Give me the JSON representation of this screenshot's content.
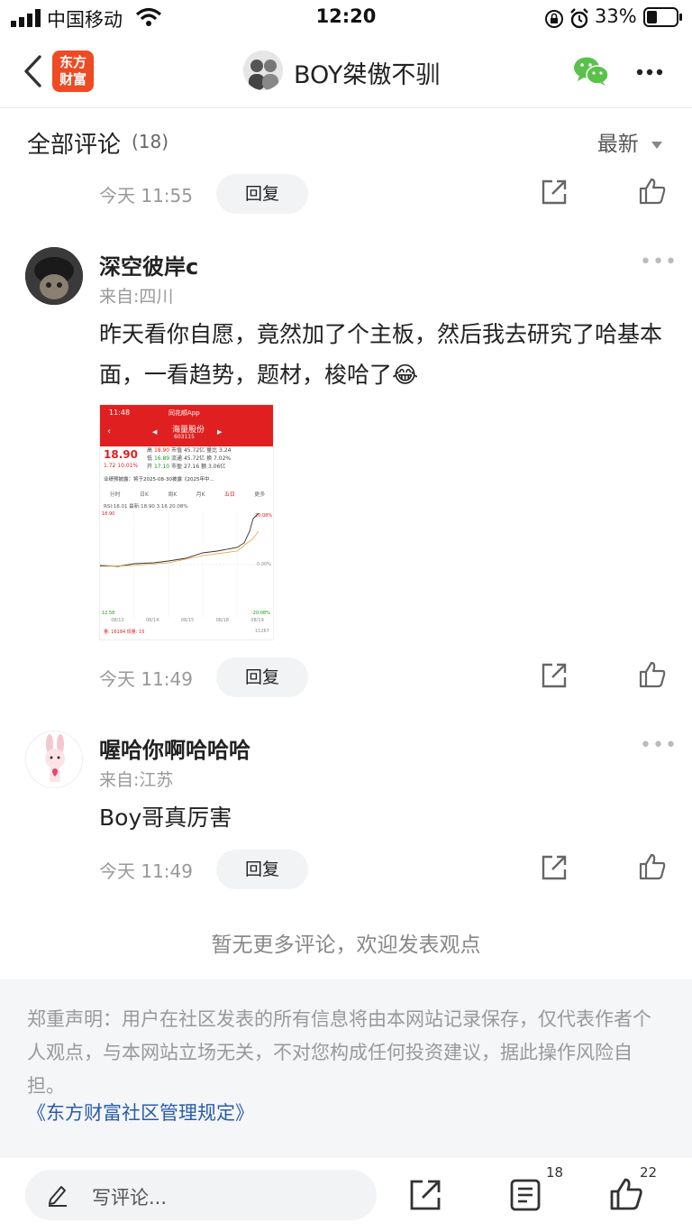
{
  "status_bar": {
    "carrier": "中国移动",
    "time": "12:20",
    "battery": "33%"
  },
  "nav": {
    "logo_text_1": "东方",
    "logo_text_2": "财富",
    "title": "BOY桀傲不驯"
  },
  "section": {
    "title": "全部评论",
    "count": "(18)",
    "sort_label": "最新"
  },
  "actions": {
    "reply_label": "回复"
  },
  "top_row": {
    "time": "今天 11:55"
  },
  "comments": [
    {
      "username": "深空彼岸c",
      "location": "来自:四川",
      "text": "昨天看你自愿，竟然加了个主板，然后我去研究了哈基本面，一看趋势，题材，梭哈了😂",
      "time": "今天 11:49"
    },
    {
      "username": "喔哈你啊哈哈哈",
      "location": "来自:江苏",
      "text": "Boy哥真厉害",
      "time": "今天 11:49"
    }
  ],
  "thumbnail": {
    "clock": "11:48",
    "app_name": "同花顺App",
    "stock_name": "海量股份",
    "stock_code": "603115",
    "price": "18.90",
    "change": "1.72",
    "change_pct": "10.01%",
    "high_label": "高",
    "high": "18.90",
    "low_label": "低",
    "low": "16.89",
    "open_label": "开",
    "open": "17.10",
    "mcap_label": "市值",
    "mcap": "45.72亿",
    "float_label": "流通",
    "float": "45.72亿",
    "pe_label": "市盈",
    "pe": "27.16",
    "ratio_label": "量比",
    "ratio": "3.24",
    "turnover_label": "换",
    "turnover": "7.02%",
    "amount_label": "额",
    "amount": "3.06亿",
    "notice": "业绩预披露：将于2025-08-30披露《2025年中...",
    "tabs": [
      "分时",
      "日K",
      "周K",
      "月K",
      "五日",
      "更多"
    ],
    "legend": "RSI:18.01  最新:18.90  3.16  20.08%",
    "top_price": "18.90",
    "top_pct": "20.08%",
    "mid_pct": "0.00%",
    "bottom_price": "12.58",
    "bottom_pct": "-20.08%",
    "dates": [
      "08/13",
      "08/14",
      "08/15",
      "08/18",
      "08/19"
    ],
    "volume": "量: 16184  现量: 15",
    "volume_right": "11267"
  },
  "footer": {
    "no_more": "暂无更多评论，欢迎发表观点",
    "disclaimer": "郑重声明：用户在社区发表的所有信息将由本网站记录保存，仅代表作者个人观点，与本网站立场无关，不对您构成任何投资建议，据此操作风险自担。",
    "rules_link": "《东方财富社区管理规定》"
  },
  "bottom_bar": {
    "input_placeholder": "写评论...",
    "comments_count": "18",
    "likes_count": "22"
  },
  "colors": {
    "accent_red": "#f04a23",
    "link_blue": "#2a5cab",
    "wechat_green": "#5ac24b",
    "stock_up": "#e02020"
  }
}
